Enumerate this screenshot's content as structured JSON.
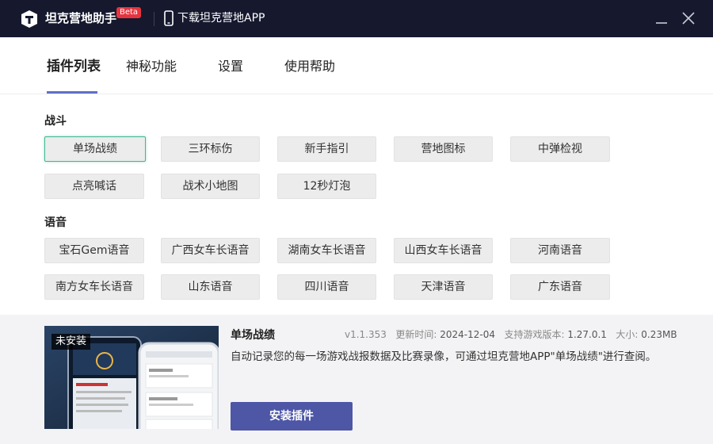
{
  "titlebar": {
    "app_name": "坦克营地助手",
    "beta_badge": "Beta",
    "download_link": "下载坦克营地APP"
  },
  "tabs": [
    {
      "label": "插件列表",
      "active": true
    },
    {
      "label": "神秘功能",
      "active": false
    },
    {
      "label": "设置",
      "active": false
    },
    {
      "label": "使用帮助",
      "active": false
    }
  ],
  "sections": [
    {
      "title": "战斗",
      "items": [
        "单场战绩",
        "三环标伤",
        "新手指引",
        "营地图标",
        "中弹检视",
        "点亮喊话",
        "战术小地图",
        "12秒灯泡"
      ]
    },
    {
      "title": "语音",
      "items": [
        "宝石Gem语音",
        "广西女车长语音",
        "湖南女车长语音",
        "山西女车长语音",
        "河南语音",
        "南方女车长语音",
        "山东语音",
        "四川语音",
        "天津语音",
        "广东语音"
      ]
    }
  ],
  "selected_plugin": "单场战绩",
  "detail": {
    "name": "单场战绩",
    "version": "v1.1.353",
    "updated_label": "更新时间:",
    "updated_value": "2024-12-04",
    "game_version_label": "支持游戏版本:",
    "game_version_value": "1.27.0.1",
    "size_label": "大小:",
    "size_value": "0.23MB",
    "description": "自动记录您的每一场游戏战报数据及比赛录像，可通过坦克营地APP\"单场战绩\"进行查阅。",
    "status_badge": "未安装",
    "install_button": "安装插件"
  },
  "colors": {
    "titlebar_bg": "#16192e",
    "accent": "#6070c8",
    "install_bg": "#4e56a6",
    "selected_border": "#3fb894",
    "beta_bg": "#e8343f"
  }
}
